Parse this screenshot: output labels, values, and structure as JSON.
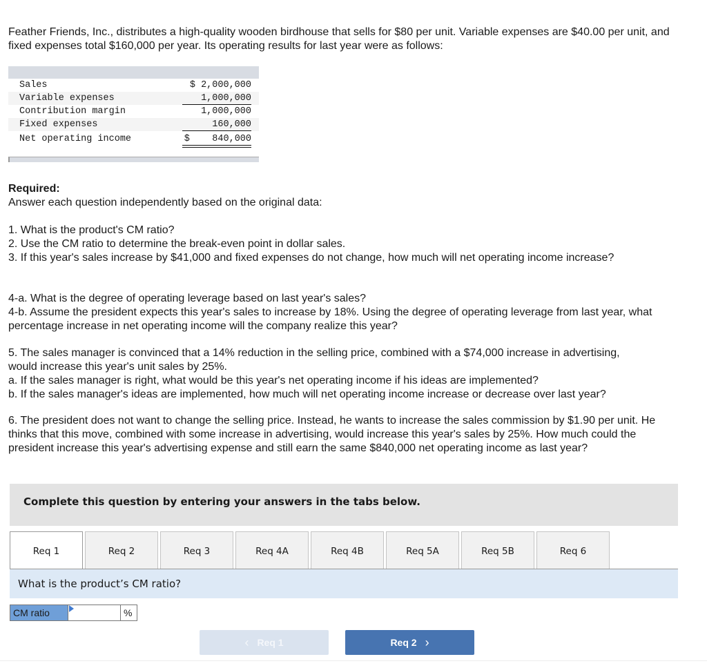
{
  "intro": "Feather Friends, Inc., distributes a high-quality wooden birdhouse that sells for $80 per unit. Variable expenses are $40.00 per unit, and fixed expenses total $160,000 per year. Its operating results for last year were as follows:",
  "income_statement": {
    "rows": [
      {
        "label": "Sales",
        "amount": "$ 2,000,000"
      },
      {
        "label": "Variable expenses",
        "amount": "1,000,000"
      },
      {
        "label": "Contribution margin",
        "amount": "1,000,000"
      },
      {
        "label": "Fixed expenses",
        "amount": "160,000"
      },
      {
        "label": "Net operating income",
        "amount": "$    840,000"
      }
    ]
  },
  "required": {
    "heading": "Required:",
    "instruction": "Answer each question independently based on the original data:",
    "q1": "1. What is the product's CM ratio?",
    "q2": "2. Use the CM ratio to determine the break-even point in dollar sales.",
    "q3": "3. If this year's sales increase by $41,000 and fixed expenses do not change, how much will net operating income increase?",
    "q4a": "4-a. What is the degree of operating leverage based on last year's sales?",
    "q4b": "4-b. Assume the president expects this year's sales to increase by 18%. Using the degree of operating leverage from last year, what percentage increase in net operating income will the company realize this year?",
    "q5": "5. The sales manager is convinced that a 14% reduction in the selling price, combined with a $74,000 increase in advertising, would increase this year's unit sales by 25%.",
    "q5a": "a. If the sales manager is right, what would be this year's net operating income if his ideas are implemented?",
    "q5b": "b. If the sales manager's ideas are implemented, how much will net operating income increase or decrease over last year?",
    "q6": "6. The president does not want to change the selling price. Instead, he wants to increase the sales commission by $1.90 per unit. He thinks that this move, combined with some increase in advertising, would increase this year's sales by 25%. How much could the president increase this year's advertising expense and still earn the same $840,000 net operating income as last year?"
  },
  "banner": "Complete this question by entering your answers in the tabs below.",
  "tabs": [
    {
      "label": "Req 1",
      "active": true
    },
    {
      "label": "Req 2"
    },
    {
      "label": "Req 3"
    },
    {
      "label": "Req 4A"
    },
    {
      "label": "Req 4B"
    },
    {
      "label": "Req 5A"
    },
    {
      "label": "Req 5B"
    },
    {
      "label": "Req 6"
    }
  ],
  "question": "What is the product’s CM ratio?",
  "answer": {
    "label": "CM ratio",
    "value": "",
    "unit": "%"
  },
  "nav": {
    "prev_label": "Req 1",
    "next_label": "Req 2",
    "prev_icon": "‹",
    "next_icon": "›"
  }
}
